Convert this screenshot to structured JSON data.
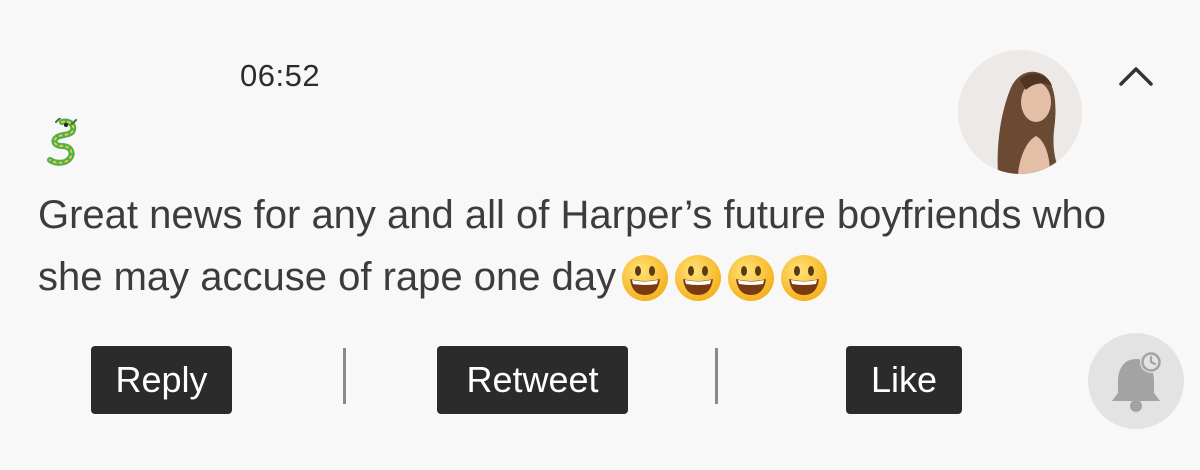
{
  "header": {
    "time": "06:52",
    "avatar_icon": "profile-photo",
    "collapse_icon": "chevron-up-icon"
  },
  "tweet": {
    "prefix_emoji_icon": "dragon-emoji",
    "text": "Great news for any and all of Harper’s future boyfriends who she may accuse of rape one day",
    "trailing_emoji_icon": "grinning-face-emoji",
    "trailing_emoji_count": 4
  },
  "actions": {
    "reply_label": "Reply",
    "retweet_label": "Retweet",
    "like_label": "Like"
  },
  "fab": {
    "icon": "bell-clock-icon"
  },
  "colors": {
    "background": "#f8f8f8",
    "button_bg": "#2b2b2b",
    "button_text": "#ffffff",
    "text": "#3c3c3c"
  }
}
